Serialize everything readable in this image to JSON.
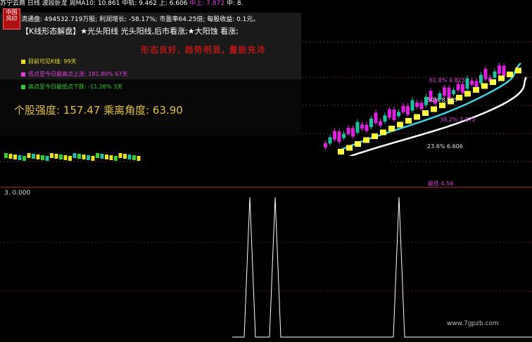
{
  "header": {
    "stock_name": "苏宁云商",
    "period": "日线",
    "indicator_name": "波段卧龙",
    "ma_label": "周MA10: 10.861",
    "mid_label": "中轨: 9.462",
    "upper_label": "上: 6.606",
    "mid_upper_label": "中上: 7.872",
    "mid_short_label": "中: 8."
  },
  "badge": {
    "line1": "中国",
    "line2": "风印"
  },
  "financials": "流通盘: 494532.719万股; 利润增长: -58.17%; 市盈率64.25倍; 每股收益: 0.1元。",
  "kline_text": "【K线形态解盘】★光头阳线 光头阳线,后市看涨;★大阳蚀 看涨;",
  "slogan": "形态良好, 趋势明显, 量能充沛",
  "stats": [
    {
      "label": "目前可见K线: 99天",
      "color": "#e8e020"
    },
    {
      "label": "低点至今日最高点上涨: 181.80% 67天",
      "color": "#e040e0"
    },
    {
      "label": "高点至今日最低点下跌: -11.26% 3天",
      "color": "#30d030"
    }
  ],
  "strength": "个股强度: 157.47  乘离角度: 63.90",
  "fib_labels": [
    {
      "text": "50%  8.895",
      "color": "#e0e0e0"
    },
    {
      "text": "61.8%  9.815",
      "color": "#e040e0"
    },
    {
      "text": "38.2%  7.872",
      "color": "#e040e0"
    },
    {
      "text": "23.6%  6.606",
      "color": "#e0e0e0"
    },
    {
      "text": "最低  4.56",
      "color": "#d040d0"
    }
  ],
  "sub_indicator": {
    "value_label": "3. 0.000"
  },
  "watermark": "www.7gpzb.com",
  "colors": {
    "up": "#e020e0",
    "down": "#20c0a0",
    "yellow": "#ffff40",
    "band_white": "#ffffff",
    "band_cyan": "#40d0e0"
  }
}
